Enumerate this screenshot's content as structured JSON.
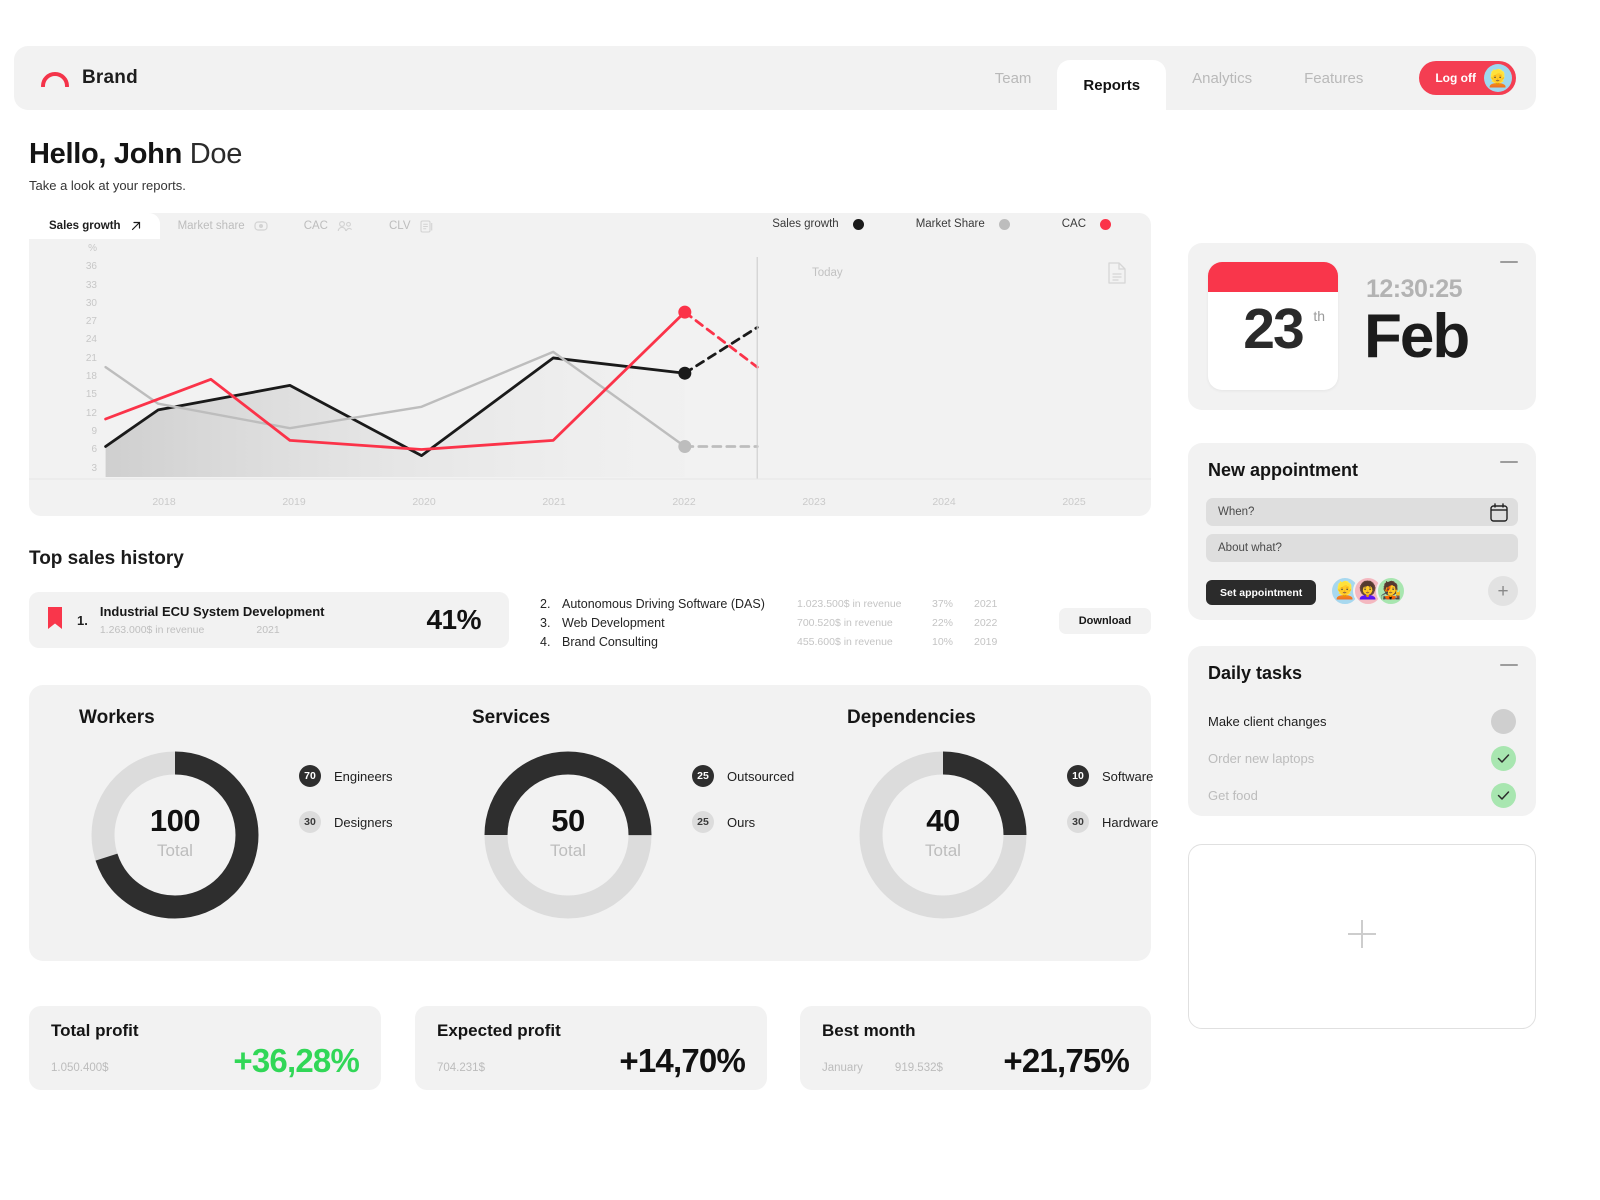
{
  "brand": {
    "name": "Brand",
    "logo_icon": "arc-logo-icon",
    "accent": "#f43e52"
  },
  "nav": {
    "items": [
      {
        "label": "Team",
        "active": false
      },
      {
        "label": "Reports",
        "active": true
      },
      {
        "label": "Analytics",
        "active": false
      },
      {
        "label": "Features",
        "active": false
      }
    ],
    "logoff_label": "Log off",
    "avatar_icon": "user-avatar"
  },
  "greeting": {
    "hello": "Hello, John",
    "last_name": " Doe",
    "subtitle": "Take a look at your reports."
  },
  "chart_card": {
    "tabs": [
      {
        "label": "Sales growth",
        "icon": "arrow-up-right-icon",
        "active": true
      },
      {
        "label": "Market share",
        "icon": "eye-icon",
        "active": false
      },
      {
        "label": "CAC",
        "icon": "people-icon",
        "active": false
      },
      {
        "label": "CLV",
        "icon": "stack-icon",
        "active": false
      }
    ],
    "legend": [
      {
        "label": "Sales growth",
        "color": "#1a1a1a"
      },
      {
        "label": "Market Share",
        "color": "#bdbdbd"
      },
      {
        "label": "CAC",
        "color": "#fb3349"
      }
    ],
    "today_label": "Today",
    "doc_icon": "document-icon"
  },
  "chart_data": {
    "type": "line",
    "title": "Sales growth",
    "xlabel": "",
    "ylabel": "%",
    "unit_label": "%",
    "x": [
      "2018",
      "2019",
      "2020",
      "2021",
      "2022",
      "2023",
      "2024",
      "2025"
    ],
    "xlim": [
      2018,
      2025
    ],
    "ylim": [
      0,
      38
    ],
    "yticks": [
      36,
      33,
      30,
      27,
      24,
      21,
      18,
      15,
      12,
      9,
      6,
      3
    ],
    "grid": false,
    "legend_position": "top-right",
    "marker_line": {
      "label": "Today",
      "x": 2022.55
    },
    "series": [
      {
        "name": "Sales growth",
        "color": "#1a1a1a",
        "area": true,
        "actual_x": [
          2017.6,
          2018,
          2019,
          2020,
          2021,
          2022
        ],
        "values": [
          5.0,
          11.0,
          15.0,
          3.5,
          19.5,
          17.0
        ],
        "forecast_x": [
          2022,
          2022.55
        ],
        "forecast_values": [
          17.0,
          24.5
        ],
        "endpoint_marker": true
      },
      {
        "name": "Market Share",
        "color": "#bdbdbd",
        "actual_x": [
          2017.6,
          2018,
          2019,
          2020,
          2021,
          2022
        ],
        "values": [
          18.0,
          12.0,
          8.0,
          11.5,
          20.5,
          5.0
        ],
        "forecast_x": [
          2022,
          2022.55
        ],
        "forecast_values": [
          5.0,
          5.0
        ],
        "endpoint_marker": true
      },
      {
        "name": "CAC",
        "color": "#fb3349",
        "actual_x": [
          2017.6,
          2018.4,
          2019,
          2020,
          2021,
          2022
        ],
        "values": [
          9.5,
          16.0,
          6.0,
          4.5,
          6.0,
          27.0
        ],
        "forecast_x": [
          2022,
          2022.55
        ],
        "forecast_values": [
          27.0,
          18.0
        ],
        "endpoint_marker": true
      }
    ]
  },
  "top_sales": {
    "title": "Top sales history",
    "download_label": "Download",
    "bookmark_icon": "bookmark-icon",
    "hero": {
      "rank": "1.",
      "name": "Industrial ECU System Development",
      "revenue": "1.263.000$ in revenue",
      "year": "2021",
      "percent": "41%"
    },
    "rows": [
      {
        "rank": "2.",
        "name": "Autonomous Driving Software (DAS)",
        "revenue": "1.023.500$ in revenue",
        "percent": "37%",
        "year": "2021"
      },
      {
        "rank": "3.",
        "name": "Web Development",
        "revenue": "700.520$ in revenue",
        "percent": "22%",
        "year": "2022"
      },
      {
        "rank": "4.",
        "name": "Brand Consulting",
        "revenue": "455.600$ in revenue",
        "percent": "10%",
        "year": "2019"
      }
    ]
  },
  "donuts": [
    {
      "title": "Workers",
      "total": "100",
      "total_label": "Total",
      "dark_percent": 70,
      "legend": [
        {
          "value": "70",
          "label": "Engineers",
          "tone": "dark"
        },
        {
          "value": "30",
          "label": "Designers",
          "tone": "light"
        }
      ]
    },
    {
      "title": "Services",
      "total": "50",
      "total_label": "Total",
      "dark_percent": 50,
      "legend": [
        {
          "value": "25",
          "label": "Outsourced",
          "tone": "dark"
        },
        {
          "value": "25",
          "label": "Ours",
          "tone": "light"
        }
      ]
    },
    {
      "title": "Dependencies",
      "total": "40",
      "total_label": "Total",
      "dark_percent": 25,
      "legend": [
        {
          "value": "10",
          "label": "Software",
          "tone": "dark"
        },
        {
          "value": "30",
          "label": "Hardware",
          "tone": "light"
        }
      ]
    }
  ],
  "stats": {
    "total_profit": {
      "title": "Total profit",
      "amount": "1.050.400$",
      "delta": "+36,28%",
      "delta_color": "#31d757"
    },
    "expected_profit": {
      "title": "Expected profit",
      "amount": "704.231$",
      "delta": "+14,70%",
      "delta_color": "#111111"
    },
    "best_month": {
      "title": "Best month",
      "month": "January",
      "amount": "919.532$",
      "delta": "+21,75%",
      "delta_color": "#111111"
    }
  },
  "sidebar": {
    "calendar": {
      "time": "12:30:25",
      "day": "23",
      "day_suffix": "th",
      "month": "Feb",
      "accent": "#f9364b"
    },
    "appointment": {
      "title": "New appointment",
      "when_placeholder": "When?",
      "about_placeholder": "About what?",
      "when_value": "",
      "about_value": "",
      "button_label": "Set appointment",
      "avatars": [
        "👱",
        "👩‍🦱",
        "🧑‍🎤"
      ],
      "add_label": "+"
    },
    "tasks": {
      "title": "Daily tasks",
      "items": [
        {
          "label": "Make client changes",
          "done": false
        },
        {
          "label": "Order new laptops",
          "done": true
        },
        {
          "label": "Get food",
          "done": true
        }
      ]
    },
    "add_card": {
      "icon": "plus-icon"
    }
  }
}
